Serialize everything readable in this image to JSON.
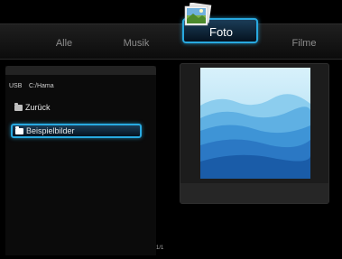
{
  "tabs": [
    {
      "label": "Alle",
      "active": false
    },
    {
      "label": "Musik",
      "active": false
    },
    {
      "label": "Foto",
      "active": true
    },
    {
      "label": "Filme",
      "active": false
    }
  ],
  "path": {
    "drive": "USB",
    "directory": "C:/Hama"
  },
  "file_list": [
    {
      "label": "Zurück",
      "icon": "folder-icon",
      "selected": false
    },
    {
      "label": "Beispielbilder",
      "icon": "folder-icon",
      "selected": true
    }
  ],
  "page_indicator": "1/1",
  "colors": {
    "accent": "#28a9e0",
    "background": "#000000"
  }
}
